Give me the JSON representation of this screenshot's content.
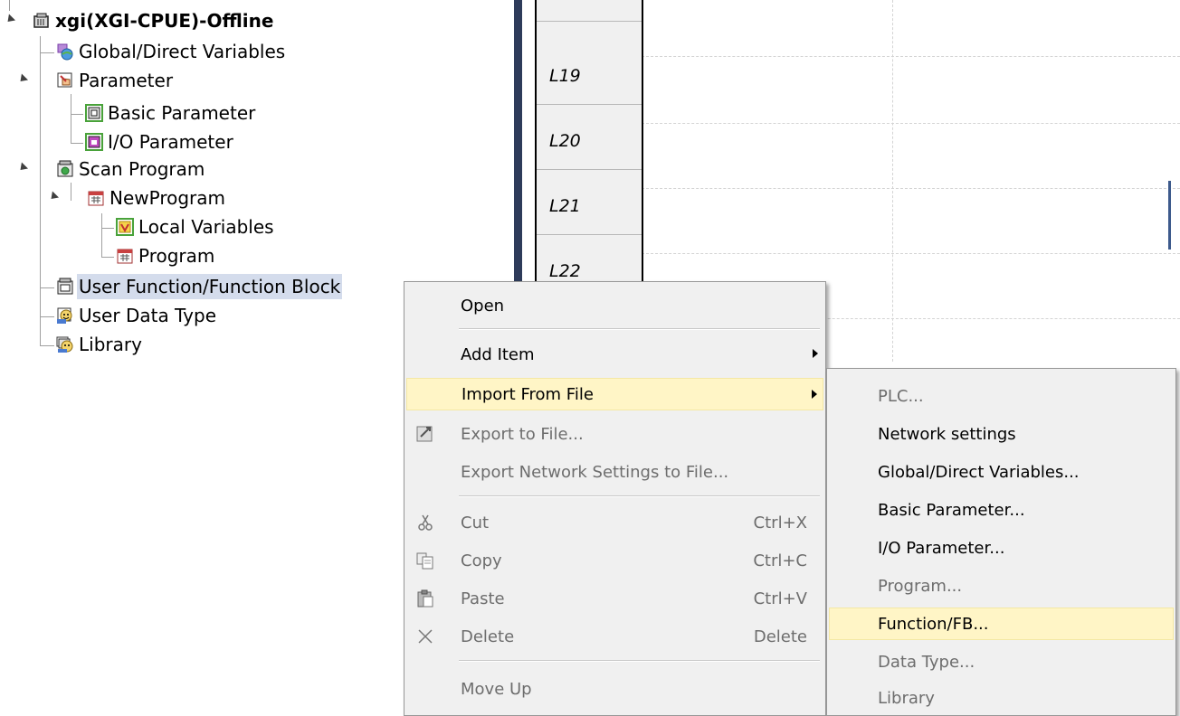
{
  "tree": {
    "root": "xgi(XGI-CPUE)-Offline",
    "items": [
      {
        "label": "Global/Direct Variables",
        "icon": "globe-variables-icon"
      },
      {
        "label": "Parameter",
        "icon": "parameter-icon"
      },
      {
        "label": "Basic Parameter",
        "icon": "basic-parameter-icon"
      },
      {
        "label": "I/O Parameter",
        "icon": "io-parameter-icon"
      },
      {
        "label": "Scan Program",
        "icon": "scan-program-icon"
      },
      {
        "label": "NewProgram",
        "icon": "program-icon"
      },
      {
        "label": "Local Variables",
        "icon": "local-variables-icon"
      },
      {
        "label": "Program",
        "icon": "program-icon"
      },
      {
        "label": "User Function/Function Block",
        "icon": "function-block-icon"
      },
      {
        "label": "User Data Type",
        "icon": "data-type-icon"
      },
      {
        "label": "Library",
        "icon": "library-icon"
      }
    ]
  },
  "editor": {
    "rungs": [
      "L19",
      "L20",
      "L21",
      "L22"
    ]
  },
  "context_menu": {
    "items": [
      {
        "label": "Open",
        "shortcut": "",
        "state": "normal"
      },
      {
        "label": "Add Item",
        "shortcut": "",
        "state": "submenu"
      },
      {
        "label": "Import From File",
        "shortcut": "",
        "state": "highlighted"
      },
      {
        "label": "Export to File...",
        "shortcut": "",
        "state": "disabled"
      },
      {
        "label": "Export Network Settings to File...",
        "shortcut": "",
        "state": "disabled"
      },
      {
        "label": "Cut",
        "shortcut": "Ctrl+X",
        "state": "disabled"
      },
      {
        "label": "Copy",
        "shortcut": "Ctrl+C",
        "state": "disabled"
      },
      {
        "label": "Paste",
        "shortcut": "Ctrl+V",
        "state": "disabled"
      },
      {
        "label": "Delete",
        "shortcut": "Delete",
        "state": "disabled"
      },
      {
        "label": "Move Up",
        "shortcut": "",
        "state": "disabled"
      }
    ]
  },
  "import_submenu": {
    "items": [
      {
        "label": "PLC...",
        "state": "disabled"
      },
      {
        "label": "Network settings",
        "state": "normal"
      },
      {
        "label": "Global/Direct Variables...",
        "state": "normal"
      },
      {
        "label": "Basic Parameter...",
        "state": "normal"
      },
      {
        "label": "I/O Parameter...",
        "state": "normal"
      },
      {
        "label": "Program...",
        "state": "disabled"
      },
      {
        "label": "Function/FB...",
        "state": "highlighted"
      },
      {
        "label": "Data Type...",
        "state": "disabled"
      },
      {
        "label": "Library",
        "state": "disabled"
      }
    ]
  },
  "colors": {
    "divider": "#2e3b5a",
    "menu_bg": "#f0f0f0",
    "highlight": "#fff5c6",
    "tree_selection": "#d4dcec"
  }
}
